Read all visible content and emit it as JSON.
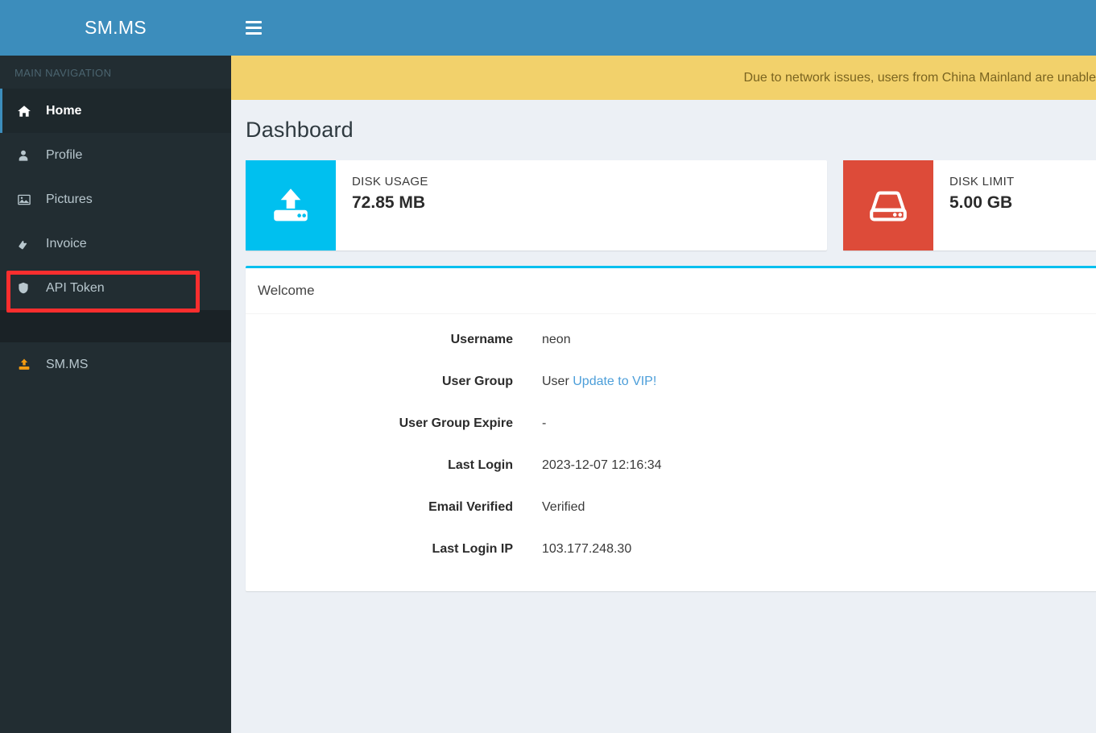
{
  "brand": {
    "logo_text": "SM.MS",
    "header_color": "#3c8dbc"
  },
  "sidebar": {
    "nav_header": "MAIN NAVIGATION",
    "items": [
      {
        "label": "Home",
        "icon": "home-icon",
        "active": true
      },
      {
        "label": "Profile",
        "icon": "user-icon",
        "active": false
      },
      {
        "label": "Pictures",
        "icon": "image-icon",
        "active": false
      },
      {
        "label": "Invoice",
        "icon": "ticket-icon",
        "active": false
      },
      {
        "label": "API Token",
        "icon": "shield-icon",
        "active": false
      },
      {
        "label": "SM.MS",
        "icon": "upload-icon",
        "active": false
      }
    ],
    "highlight": {
      "target": "API Token",
      "color": "#fa2e2e"
    }
  },
  "topbar": {
    "menu_toggle": "hamburger-icon"
  },
  "notice": {
    "text": "Due to network issues, users from China Mainland are unable",
    "background": "#f2d16b"
  },
  "main": {
    "page_title": "Dashboard",
    "info_boxes": [
      {
        "title": "DISK USAGE",
        "value": "72.85 MB",
        "icon": "upload-drive-icon",
        "color": "#00c0ef"
      },
      {
        "title": "DISK LIMIT",
        "value": "5.00 GB",
        "icon": "hard-drive-icon",
        "color": "#dd4b39"
      }
    ],
    "panel": {
      "title": "Welcome",
      "accent_color": "#00c0ef",
      "rows": [
        {
          "label": "Username",
          "value": "neon",
          "link": ""
        },
        {
          "label": "User Group",
          "value": "User",
          "link": "Update to VIP!"
        },
        {
          "label": "User Group Expire",
          "value": "-",
          "link": ""
        },
        {
          "label": "Last Login",
          "value": "2023-12-07 12:16:34",
          "link": ""
        },
        {
          "label": "Email Verified",
          "value": "Verified",
          "link": ""
        },
        {
          "label": "Last Login IP",
          "value": "103.177.248.30",
          "link": ""
        }
      ]
    }
  }
}
